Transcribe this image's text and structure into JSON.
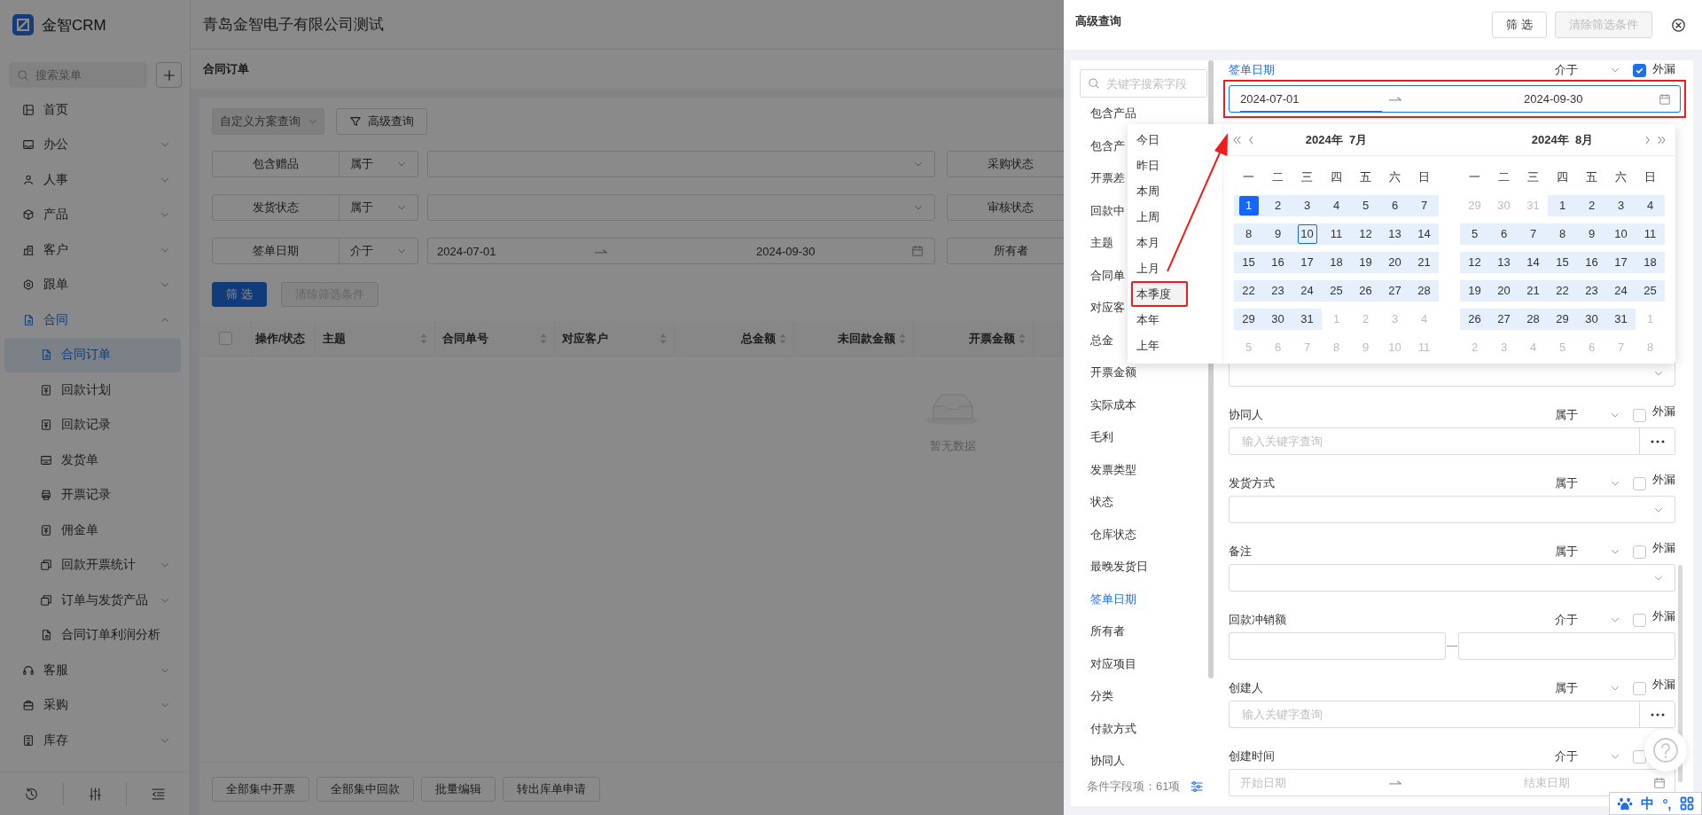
{
  "app": {
    "logo": "金智CRM",
    "company": "青岛金智电子有限公司测试",
    "menu_search": {
      "placeholder": "搜索菜单"
    },
    "menu": [
      {
        "label": "首页",
        "selected": false
      },
      {
        "label": "办公",
        "selected": false,
        "expanded": false
      },
      {
        "label": "人事",
        "selected": false,
        "expanded": false
      },
      {
        "label": "产品",
        "selected": false,
        "expanded": false
      },
      {
        "label": "客户",
        "selected": false,
        "expanded": false
      },
      {
        "label": "跟单",
        "selected": false,
        "expanded": false
      },
      {
        "label": "合同",
        "selected": false,
        "expanded": true,
        "children": [
          {
            "label": "合同订单",
            "selected": true
          },
          {
            "label": "回款计划",
            "selected": false
          },
          {
            "label": "回款记录",
            "selected": false
          },
          {
            "label": "发货单",
            "selected": false
          },
          {
            "label": "开票记录",
            "selected": false
          },
          {
            "label": "佣金单",
            "selected": false
          },
          {
            "label": "回款开票统计",
            "selected": false,
            "expanded": false
          },
          {
            "label": "订单与发货产品",
            "selected": false,
            "expanded": false
          },
          {
            "label": "合同订单利润分析",
            "selected": false
          }
        ]
      },
      {
        "label": "客服",
        "selected": false,
        "expanded": false
      },
      {
        "label": "采购",
        "selected": false,
        "expanded": false
      },
      {
        "label": "库存",
        "selected": false,
        "expanded": false
      }
    ],
    "page_title": "合同订单",
    "scheme_select": {
      "placeholder": "自定义方案查询",
      "disabled": true
    },
    "advanced_button": "高级查询",
    "filters": [
      {
        "label": "包含赠品",
        "operator": "属于",
        "kind": "select",
        "side_label": "采购状态"
      },
      {
        "label": "发货状态",
        "operator": "属于",
        "kind": "select",
        "side_label": "审核状态"
      },
      {
        "label": "签单日期",
        "operator": "介于",
        "kind": "date_range",
        "start": "2024-07-01",
        "end": "2024-09-30",
        "side_label": "所有者"
      }
    ],
    "actions": [
      {
        "label": "筛 选",
        "primary": true,
        "disabled": false
      },
      {
        "label": "清除筛选条件",
        "primary": false,
        "disabled": true
      }
    ],
    "table": {
      "select_all": false,
      "columns": [
        {
          "title": "操作/状态",
          "sortable": false,
          "kind": "text"
        },
        {
          "title": "主题",
          "sortable": true,
          "kind": "text"
        },
        {
          "title": "合同单号",
          "sortable": true,
          "kind": "text"
        },
        {
          "title": "对应客户",
          "sortable": true,
          "kind": "text"
        },
        {
          "title": "总金额",
          "sortable": true,
          "kind": "amount"
        },
        {
          "title": "未回款金额",
          "sortable": true,
          "kind": "amount"
        },
        {
          "title": "开票金额",
          "sortable": true,
          "kind": "amount"
        }
      ],
      "empty_text": "暂无数据"
    },
    "footer_buttons": [
      "全部集中开票",
      "全部集中回款",
      "批量编辑",
      "转出库单申请"
    ]
  },
  "drawer": {
    "title": "高级查询",
    "buttons": [
      {
        "label": "筛 选",
        "disabled": false
      },
      {
        "label": "清除筛选条件",
        "disabled": true
      }
    ],
    "field_list": {
      "search": {
        "placeholder": "关键字搜索字段"
      },
      "items": [
        {
          "label": "包含产品",
          "selected": false
        },
        {
          "label": "包含产",
          "selected": false
        },
        {
          "label": "开票差",
          "selected": false
        },
        {
          "label": "回款中",
          "selected": false
        },
        {
          "label": "主题",
          "selected": false
        },
        {
          "label": "合同单",
          "selected": false
        },
        {
          "label": "对应客",
          "selected": false
        },
        {
          "label": "总金",
          "selected": false
        },
        {
          "label": "开票金额",
          "selected": false
        },
        {
          "label": "实际成本",
          "selected": false
        },
        {
          "label": "毛利",
          "selected": false
        },
        {
          "label": "发票类型",
          "selected": false
        },
        {
          "label": "状态",
          "selected": false
        },
        {
          "label": "仓库状态",
          "selected": false
        },
        {
          "label": "最晚发货日",
          "selected": false
        },
        {
          "label": "签单日期",
          "selected": true
        },
        {
          "label": "所有者",
          "selected": false
        },
        {
          "label": "对应项目",
          "selected": false
        },
        {
          "label": "分类",
          "selected": false
        },
        {
          "label": "付款方式",
          "selected": false
        },
        {
          "label": "协同人",
          "selected": false
        }
      ],
      "count": "条件字段项：61项"
    },
    "form": [
      {
        "label": "签单日期",
        "active": true,
        "operator": "介于",
        "exclude": true,
        "exclude_label": "外漏",
        "kind": "date_range",
        "start": "2024-07-01",
        "end": "2024-09-30",
        "focused": true,
        "highlighted": true
      },
      {
        "kind": "select",
        "focused": false,
        "highlighted": false
      },
      {
        "label": "协同人",
        "active": false,
        "operator": "属于",
        "exclude": false,
        "exclude_label": "外漏",
        "kind": "picker",
        "placeholder": "输入关键字查询",
        "focused": false,
        "highlighted": false
      },
      {
        "label": "发货方式",
        "active": false,
        "operator": "属于",
        "exclude": false,
        "exclude_label": "外漏",
        "kind": "select",
        "focused": false,
        "highlighted": false
      },
      {
        "label": "备注",
        "active": false,
        "operator": "属于",
        "exclude": false,
        "exclude_label": "外漏",
        "kind": "select",
        "focused": false,
        "highlighted": false
      },
      {
        "label": "回款冲销额",
        "active": false,
        "operator": "介于",
        "exclude": false,
        "exclude_label": "外漏",
        "kind": "number_range",
        "focused": false,
        "highlighted": false
      },
      {
        "label": "创建人",
        "active": false,
        "operator": "属于",
        "exclude": false,
        "exclude_label": "外漏",
        "kind": "picker",
        "placeholder": "输入关键字查询",
        "focused": false,
        "highlighted": false
      },
      {
        "label": "创建时间",
        "active": false,
        "operator": "介于",
        "exclude": false,
        "kind": "date_range",
        "start_placeholder": "开始日期",
        "end_placeholder": "结束日期",
        "focused": false,
        "highlighted": false
      }
    ],
    "date_picker": {
      "shortcuts": [
        {
          "label": "今日",
          "hovered": false,
          "highlighted": false
        },
        {
          "label": "昨日",
          "hovered": false,
          "highlighted": false
        },
        {
          "label": "本周",
          "hovered": false,
          "highlighted": false
        },
        {
          "label": "上周",
          "hovered": false,
          "highlighted": false
        },
        {
          "label": "本月",
          "hovered": false,
          "highlighted": false
        },
        {
          "label": "上月",
          "hovered": false,
          "highlighted": false
        },
        {
          "label": "本季度",
          "hovered": true,
          "highlighted": true
        },
        {
          "label": "本年",
          "hovered": false,
          "highlighted": false
        },
        {
          "label": "上年",
          "hovered": false,
          "highlighted": false
        }
      ],
      "months": [
        {
          "title": "2024年  7月",
          "weekdays": [
            "一",
            "二",
            "三",
            "四",
            "五",
            "六",
            "日"
          ],
          "weeks": [
            [
              {
                "day": "1",
                "kind": "start"
              },
              {
                "day": "2",
                "kind": "range"
              },
              {
                "day": "3",
                "kind": "range"
              },
              {
                "day": "4",
                "kind": "range"
              },
              {
                "day": "5",
                "kind": "range"
              },
              {
                "day": "6",
                "kind": "range"
              },
              {
                "day": "7",
                "kind": "range"
              }
            ],
            [
              {
                "day": "8",
                "kind": "range"
              },
              {
                "day": "9",
                "kind": "range"
              },
              {
                "day": "10",
                "kind": "today"
              },
              {
                "day": "11",
                "kind": "range"
              },
              {
                "day": "12",
                "kind": "range"
              },
              {
                "day": "13",
                "kind": "range"
              },
              {
                "day": "14",
                "kind": "range"
              }
            ],
            [
              {
                "day": "15",
                "kind": "range"
              },
              {
                "day": "16",
                "kind": "range"
              },
              {
                "day": "17",
                "kind": "range"
              },
              {
                "day": "18",
                "kind": "range"
              },
              {
                "day": "19",
                "kind": "range"
              },
              {
                "day": "20",
                "kind": "range"
              },
              {
                "day": "21",
                "kind": "range"
              }
            ],
            [
              {
                "day": "22",
                "kind": "range"
              },
              {
                "day": "23",
                "kind": "range"
              },
              {
                "day": "24",
                "kind": "range"
              },
              {
                "day": "25",
                "kind": "range"
              },
              {
                "day": "26",
                "kind": "range"
              },
              {
                "day": "27",
                "kind": "range"
              },
              {
                "day": "28",
                "kind": "range"
              }
            ],
            [
              {
                "day": "29",
                "kind": "range"
              },
              {
                "day": "30",
                "kind": "range"
              },
              {
                "day": "31",
                "kind": "range"
              },
              {
                "day": "1",
                "kind": "other"
              },
              {
                "day": "2",
                "kind": "other"
              },
              {
                "day": "3",
                "kind": "other"
              },
              {
                "day": "4",
                "kind": "other"
              }
            ],
            [
              {
                "day": "5",
                "kind": "other"
              },
              {
                "day": "6",
                "kind": "other"
              },
              {
                "day": "7",
                "kind": "other"
              },
              {
                "day": "8",
                "kind": "other"
              },
              {
                "day": "9",
                "kind": "other"
              },
              {
                "day": "10",
                "kind": "other"
              },
              {
                "day": "11",
                "kind": "other"
              }
            ]
          ]
        },
        {
          "title": "2024年  8月",
          "weekdays": [
            "一",
            "二",
            "三",
            "四",
            "五",
            "六",
            "日"
          ],
          "weeks": [
            [
              {
                "day": "29",
                "kind": "other"
              },
              {
                "day": "30",
                "kind": "other"
              },
              {
                "day": "31",
                "kind": "other"
              },
              {
                "day": "1",
                "kind": "range"
              },
              {
                "day": "2",
                "kind": "range"
              },
              {
                "day": "3",
                "kind": "range"
              },
              {
                "day": "4",
                "kind": "range"
              }
            ],
            [
              {
                "day": "5",
                "kind": "range"
              },
              {
                "day": "6",
                "kind": "range"
              },
              {
                "day": "7",
                "kind": "range"
              },
              {
                "day": "8",
                "kind": "range"
              },
              {
                "day": "9",
                "kind": "range"
              },
              {
                "day": "10",
                "kind": "range"
              },
              {
                "day": "11",
                "kind": "range"
              }
            ],
            [
              {
                "day": "12",
                "kind": "range"
              },
              {
                "day": "13",
                "kind": "range"
              },
              {
                "day": "14",
                "kind": "range"
              },
              {
                "day": "15",
                "kind": "range"
              },
              {
                "day": "16",
                "kind": "range"
              },
              {
                "day": "17",
                "kind": "range"
              },
              {
                "day": "18",
                "kind": "range"
              }
            ],
            [
              {
                "day": "19",
                "kind": "range"
              },
              {
                "day": "20",
                "kind": "range"
              },
              {
                "day": "21",
                "kind": "range"
              },
              {
                "day": "22",
                "kind": "range"
              },
              {
                "day": "23",
                "kind": "range"
              },
              {
                "day": "24",
                "kind": "range"
              },
              {
                "day": "25",
                "kind": "range"
              }
            ],
            [
              {
                "day": "26",
                "kind": "range"
              },
              {
                "day": "27",
                "kind": "range"
              },
              {
                "day": "28",
                "kind": "range"
              },
              {
                "day": "29",
                "kind": "range"
              },
              {
                "day": "30",
                "kind": "range"
              },
              {
                "day": "31",
                "kind": "range"
              },
              {
                "day": "1",
                "kind": "other"
              }
            ],
            [
              {
                "day": "2",
                "kind": "other"
              },
              {
                "day": "3",
                "kind": "other"
              },
              {
                "day": "4",
                "kind": "other"
              },
              {
                "day": "5",
                "kind": "other"
              },
              {
                "day": "6",
                "kind": "other"
              },
              {
                "day": "7",
                "kind": "other"
              },
              {
                "day": "8",
                "kind": "other"
              }
            ]
          ]
        }
      ]
    }
  },
  "annotation_arrow": true,
  "ime_bar": {
    "mode": "中",
    "punctuation": "°,"
  }
}
